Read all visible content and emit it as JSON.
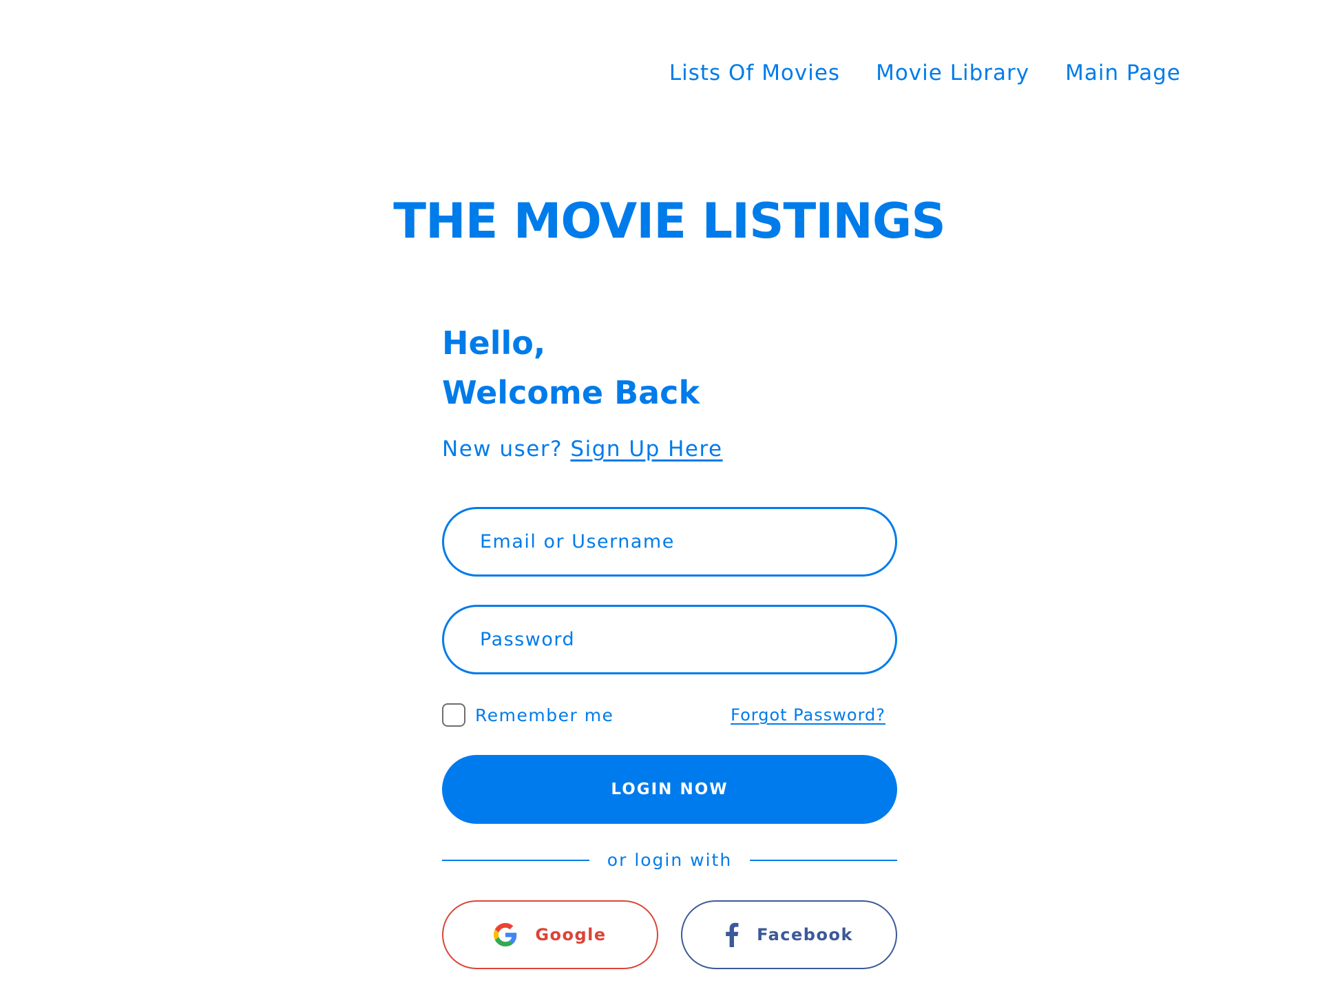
{
  "nav": {
    "items": [
      "Lists Of Movies",
      "Movie Library",
      "Main Page"
    ]
  },
  "brand": {
    "title": "THE MOVIE LISTINGS"
  },
  "login": {
    "greeting_line1": "Hello,",
    "greeting_line2": "Welcome Back",
    "new_user_text": "New user?",
    "signup_link": "Sign Up Here",
    "email_placeholder": "Email or Username",
    "password_placeholder": "Password",
    "remember_label": "Remember me",
    "remember_checked": false,
    "forgot_link": "Forgot Password?",
    "login_button": "LOGIN NOW",
    "divider_text": "or login with",
    "google_label": "Google",
    "facebook_label": "Facebook"
  },
  "colors": {
    "accent": "#007bea",
    "google": "#db4437",
    "facebook": "#3b5998"
  }
}
